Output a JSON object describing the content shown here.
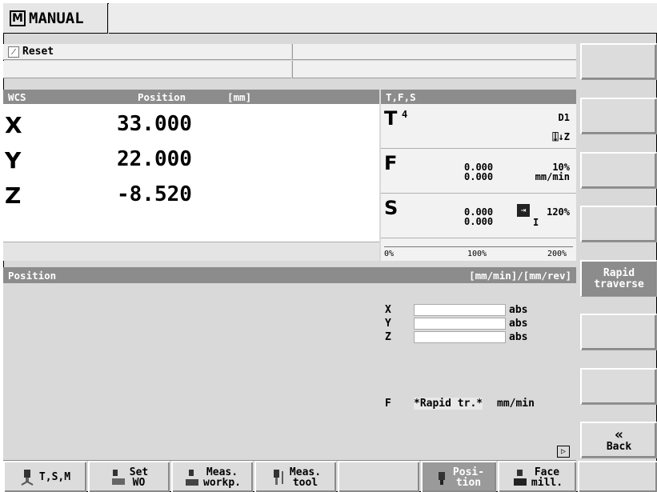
{
  "mode": {
    "label": "MANUAL",
    "icon": "manual-mode-icon"
  },
  "status": {
    "reset_label": "Reset"
  },
  "wcs": {
    "header_left": "WCS",
    "header_mid": "Position",
    "header_unit": "[mm]",
    "axes": [
      {
        "name": "X",
        "value": "33.000"
      },
      {
        "name": "Y",
        "value": "22.000"
      },
      {
        "name": "Z",
        "value": "-8.520"
      }
    ]
  },
  "tfs": {
    "header": "T,F,S",
    "tool_letter": "T",
    "tool_number": "4",
    "tool_d": "D1",
    "tool_dir": "Z",
    "feed_letter": "F",
    "feed_val1": "0.000",
    "feed_val2": "0.000",
    "feed_pct": "10%",
    "feed_unit": "mm/min",
    "spindle_letter": "S",
    "spindle_val1": "0.000",
    "spindle_val2": "0.000",
    "spindle_pct": "120%",
    "spindle_roman": "I",
    "scale": [
      "0%",
      "100%",
      "200%"
    ]
  },
  "position": {
    "header": "Position",
    "unit": "[mm/min]/[mm/rev]",
    "fields": [
      {
        "axis": "X",
        "value": "",
        "suffix": "abs"
      },
      {
        "axis": "Y",
        "value": "",
        "suffix": "abs"
      },
      {
        "axis": "Z",
        "value": "",
        "suffix": "abs"
      }
    ],
    "feed_label": "F",
    "feed_value": "*Rapid tr.*",
    "feed_unit": "mm/min"
  },
  "softkeys_right": [
    {
      "label": ""
    },
    {
      "label": ""
    },
    {
      "label": ""
    },
    {
      "label": ""
    },
    {
      "label": "Rapid\ntraverse"
    },
    {
      "label": ""
    },
    {
      "label": ""
    },
    {
      "label": "Back",
      "arrow": "«"
    }
  ],
  "softkeys_bottom": [
    {
      "label": "T,S,M",
      "icon": "tool-spindle-icon"
    },
    {
      "label": "Set\nWO",
      "icon": "set-wo-icon"
    },
    {
      "label": "Meas.\nworkp.",
      "icon": "measure-workpiece-icon"
    },
    {
      "label": "Meas.\ntool",
      "icon": "measure-tool-icon"
    },
    {
      "label": "",
      "icon": ""
    },
    {
      "label": "Posi-\ntion",
      "icon": "position-icon"
    },
    {
      "label": "Face\nmill.",
      "icon": "face-mill-icon"
    },
    {
      "label": "",
      "icon": ""
    }
  ],
  "colors": {
    "header_bg": "#8c8c8c",
    "active_softkey": "#8c8c8c",
    "panel_bg": "#d9d9d9"
  }
}
